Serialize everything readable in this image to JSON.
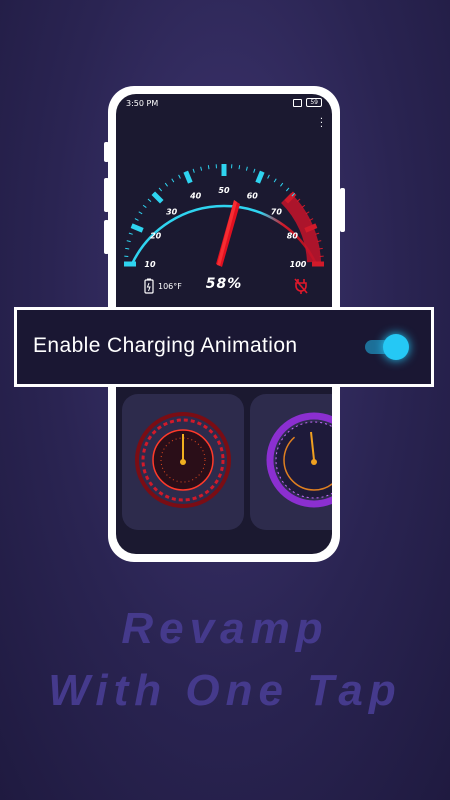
{
  "status_bar": {
    "time": "3:50 PM",
    "battery": "59"
  },
  "gauge": {
    "labels": [
      "10",
      "20",
      "30",
      "40",
      "50",
      "60",
      "70",
      "80",
      "100"
    ],
    "accent_color": "#2fd4f0",
    "danger_color": "#d11a2a",
    "needle_color": "#e01020"
  },
  "info": {
    "temperature": "106°F",
    "battery_percent": "58%"
  },
  "toggle_card": {
    "label": "Enable Charging Animation",
    "enabled": true,
    "accent_color": "#25c8f5"
  },
  "tagline": {
    "line1": "Revamp",
    "line2": "With One Tap"
  }
}
